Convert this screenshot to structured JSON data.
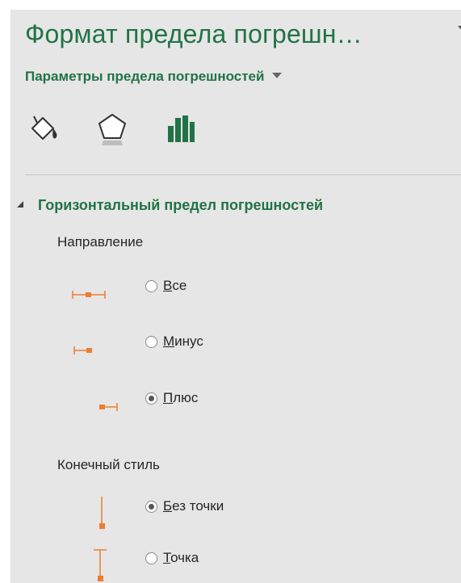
{
  "pane": {
    "title": "Формат предела погрешн…",
    "subtitle": "Параметры предела погрешностей",
    "tabs": [
      {
        "icon": "paint-bucket-icon"
      },
      {
        "icon": "pentagon-effects-icon"
      },
      {
        "icon": "bar-chart-icon",
        "selected": true
      }
    ],
    "colors": {
      "accent": "#217346",
      "glyph": "#ed7d31",
      "pane_bg": "#e6e6e6"
    }
  },
  "section": {
    "header": "Горизонтальный предел погрешностей",
    "direction": {
      "label": "Направление",
      "options": [
        {
          "hotkey": "В",
          "rest": "се",
          "checked": false
        },
        {
          "hotkey": "М",
          "rest": "инус",
          "checked": false
        },
        {
          "hotkey": "П",
          "rest": "люс",
          "checked": true
        }
      ]
    },
    "end_style": {
      "label": "Конечный стиль",
      "options": [
        {
          "hotkey": "Б",
          "rest": "ез точки",
          "checked": true
        },
        {
          "hotkey": "Т",
          "rest": "очка",
          "checked": false
        }
      ]
    }
  }
}
